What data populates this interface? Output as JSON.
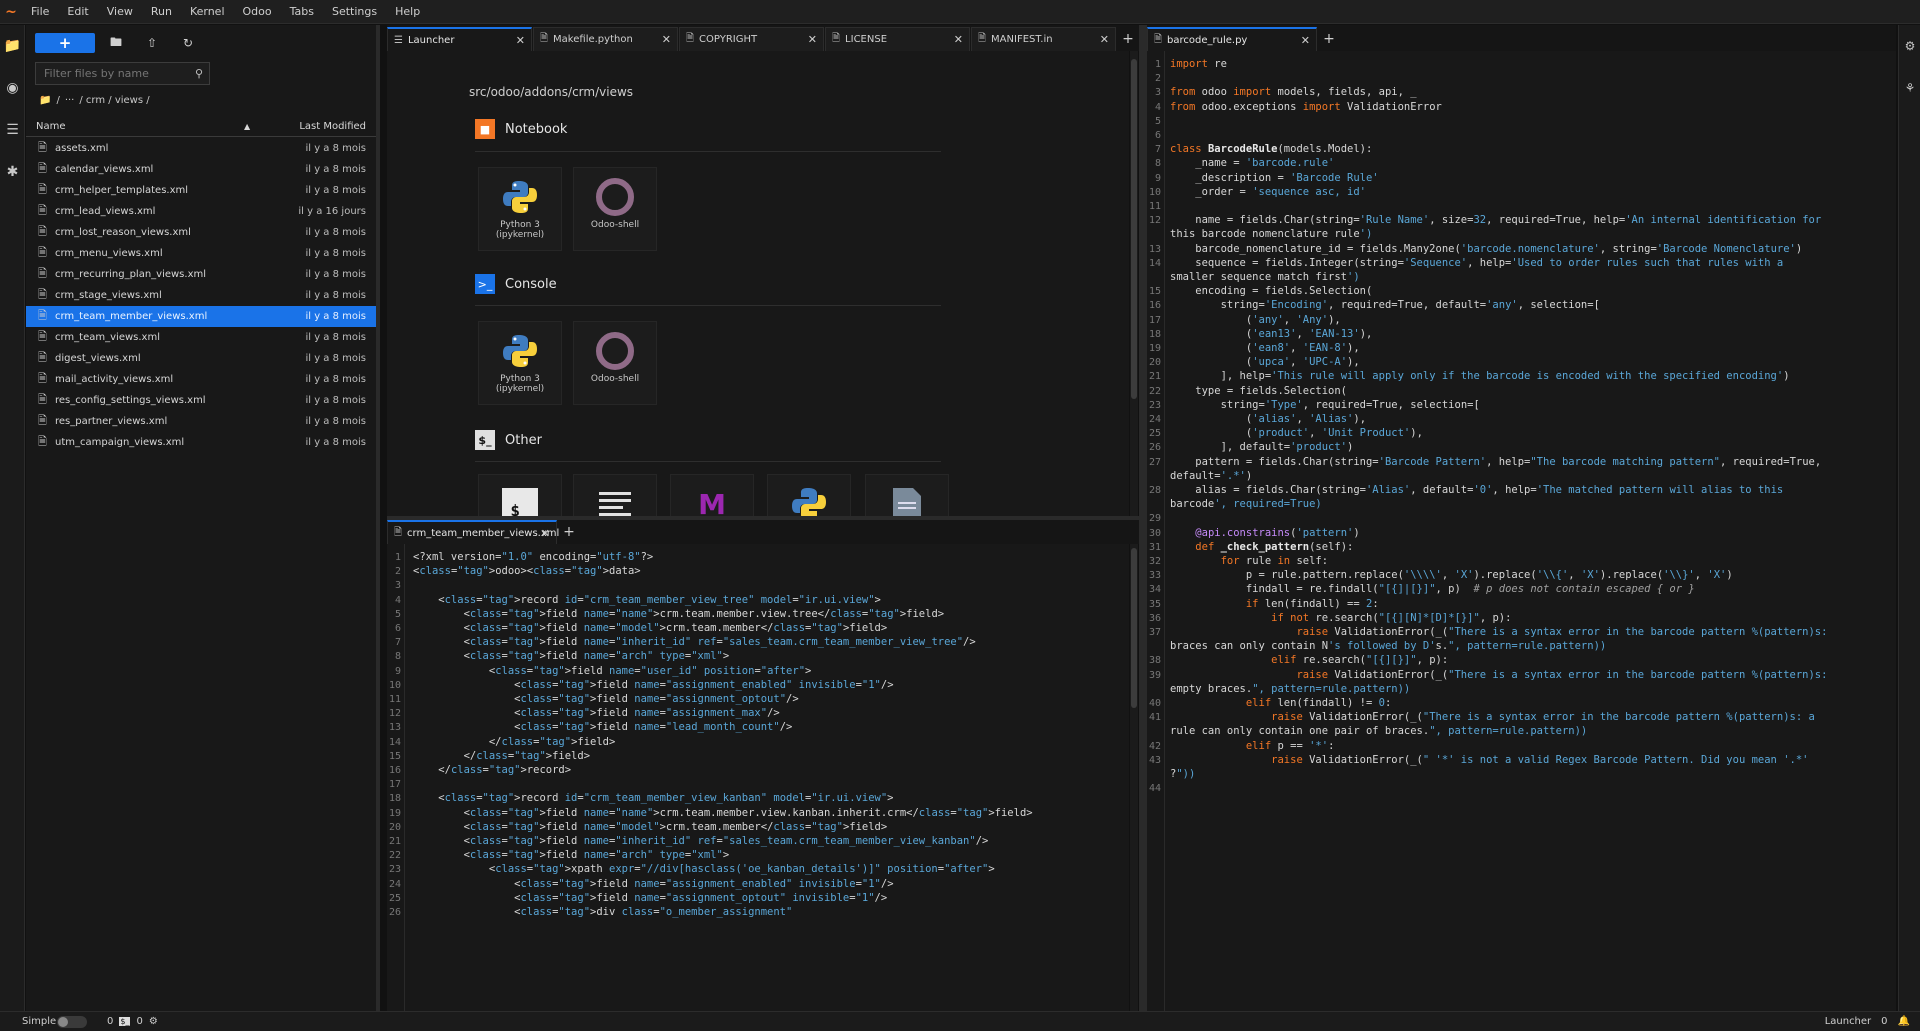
{
  "menubar": {
    "logo": "~",
    "items": [
      "File",
      "Edit",
      "View",
      "Run",
      "Kernel",
      "Odoo",
      "Tabs",
      "Settings",
      "Help"
    ]
  },
  "filebrowser": {
    "new_label": "+",
    "filter_placeholder": "Filter files by name",
    "breadcrumb": [
      "/",
      "···",
      "/ crm / views /"
    ],
    "col_name": "Name",
    "col_modified": "Last Modified",
    "files": [
      {
        "name": "assets.xml",
        "modified": "il y a 8 mois"
      },
      {
        "name": "calendar_views.xml",
        "modified": "il y a 8 mois"
      },
      {
        "name": "crm_helper_templates.xml",
        "modified": "il y a 8 mois"
      },
      {
        "name": "crm_lead_views.xml",
        "modified": "il y a 16 jours"
      },
      {
        "name": "crm_lost_reason_views.xml",
        "modified": "il y a 8 mois"
      },
      {
        "name": "crm_menu_views.xml",
        "modified": "il y a 8 mois"
      },
      {
        "name": "crm_recurring_plan_views.xml",
        "modified": "il y a 8 mois"
      },
      {
        "name": "crm_stage_views.xml",
        "modified": "il y a 8 mois"
      },
      {
        "name": "crm_team_member_views.xml",
        "modified": "il y a 8 mois",
        "selected": true
      },
      {
        "name": "crm_team_views.xml",
        "modified": "il y a 8 mois"
      },
      {
        "name": "digest_views.xml",
        "modified": "il y a 8 mois"
      },
      {
        "name": "mail_activity_views.xml",
        "modified": "il y a 8 mois"
      },
      {
        "name": "res_config_settings_views.xml",
        "modified": "il y a 8 mois"
      },
      {
        "name": "res_partner_views.xml",
        "modified": "il y a 8 mois"
      },
      {
        "name": "utm_campaign_views.xml",
        "modified": "il y a 8 mois"
      }
    ]
  },
  "top_tabs": [
    {
      "label": "Launcher",
      "active": true
    },
    {
      "label": "Makefile.python",
      "active": false
    },
    {
      "label": "COPYRIGHT",
      "active": false
    },
    {
      "label": "LICENSE",
      "active": false
    },
    {
      "label": "MANIFEST.in",
      "active": false
    }
  ],
  "right_tabs": [
    {
      "label": "barcode_rule.py",
      "active": true
    }
  ],
  "bottom_tabs": [
    {
      "label": "crm_team_member_views.xml",
      "active": true
    }
  ],
  "launcher": {
    "path": "src/odoo/addons/crm/views",
    "notebook_title": "Notebook",
    "console_title": "Console",
    "other_title": "Other",
    "kernels": [
      {
        "label_line1": "Python 3",
        "label_line2": "(ipykernel)"
      },
      {
        "label_line1": "Odoo-shell",
        "label_line2": ""
      }
    ]
  },
  "xml_code": [
    "<?xml version=\"1.0\" encoding=\"utf-8\"?>",
    "<odoo><data>",
    "",
    "    <record id=\"crm_team_member_view_tree\" model=\"ir.ui.view\">",
    "        <field name=\"name\">crm.team.member.view.tree</field>",
    "        <field name=\"model\">crm.team.member</field>",
    "        <field name=\"inherit_id\" ref=\"sales_team.crm_team_member_view_tree\"/>",
    "        <field name=\"arch\" type=\"xml\">",
    "            <field name=\"user_id\" position=\"after\">",
    "                <field name=\"assignment_enabled\" invisible=\"1\"/>",
    "                <field name=\"assignment_optout\"/>",
    "                <field name=\"assignment_max\"/>",
    "                <field name=\"lead_month_count\"/>",
    "            </field>",
    "        </field>",
    "    </record>",
    "",
    "    <record id=\"crm_team_member_view_kanban\" model=\"ir.ui.view\">",
    "        <field name=\"name\">crm.team.member.view.kanban.inherit.crm</field>",
    "        <field name=\"model\">crm.team.member</field>",
    "        <field name=\"inherit_id\" ref=\"sales_team.crm_team_member_view_kanban\"/>",
    "        <field name=\"arch\" type=\"xml\">",
    "            <xpath expr=\"//div[hasclass('oe_kanban_details')]\" position=\"after\">",
    "                <field name=\"assignment_enabled\" invisible=\"1\"/>",
    "                <field name=\"assignment_optout\" invisible=\"1\"/>",
    "                <div class=\"o_member_assignment\""
  ],
  "py_code": [
    {
      "n": "1",
      "t": "import re"
    },
    {
      "n": "2",
      "t": ""
    },
    {
      "n": "3",
      "t": "from odoo import models, fields, api, _"
    },
    {
      "n": "4",
      "t": "from odoo.exceptions import ValidationError"
    },
    {
      "n": "5",
      "t": ""
    },
    {
      "n": "6",
      "t": ""
    },
    {
      "n": "7",
      "t": "class BarcodeRule(models.Model):"
    },
    {
      "n": "8",
      "t": "    _name = 'barcode.rule'"
    },
    {
      "n": "9",
      "t": "    _description = 'Barcode Rule'"
    },
    {
      "n": "10",
      "t": "    _order = 'sequence asc, id'"
    },
    {
      "n": "11",
      "t": ""
    },
    {
      "n": "12",
      "t": "    name = fields.Char(string='Rule Name', size=32, required=True, help='An internal identification for"
    },
    {
      "n": "",
      "t": "this barcode nomenclature rule')"
    },
    {
      "n": "13",
      "t": "    barcode_nomenclature_id = fields.Many2one('barcode.nomenclature', string='Barcode Nomenclature')"
    },
    {
      "n": "14",
      "t": "    sequence = fields.Integer(string='Sequence', help='Used to order rules such that rules with a"
    },
    {
      "n": "",
      "t": "smaller sequence match first')"
    },
    {
      "n": "15",
      "t": "    encoding = fields.Selection("
    },
    {
      "n": "16",
      "t": "        string='Encoding', required=True, default='any', selection=["
    },
    {
      "n": "17",
      "t": "            ('any', 'Any'),"
    },
    {
      "n": "18",
      "t": "            ('ean13', 'EAN-13'),"
    },
    {
      "n": "19",
      "t": "            ('ean8', 'EAN-8'),"
    },
    {
      "n": "20",
      "t": "            ('upca', 'UPC-A'),"
    },
    {
      "n": "21",
      "t": "        ], help='This rule will apply only if the barcode is encoded with the specified encoding')"
    },
    {
      "n": "22",
      "t": "    type = fields.Selection("
    },
    {
      "n": "23",
      "t": "        string='Type', required=True, selection=["
    },
    {
      "n": "24",
      "t": "            ('alias', 'Alias'),"
    },
    {
      "n": "25",
      "t": "            ('product', 'Unit Product'),"
    },
    {
      "n": "26",
      "t": "        ], default='product')"
    },
    {
      "n": "27",
      "t": "    pattern = fields.Char(string='Barcode Pattern', help=\"The barcode matching pattern\", required=True,"
    },
    {
      "n": "",
      "t": "default='.*')"
    },
    {
      "n": "28",
      "t": "    alias = fields.Char(string='Alias', default='0', help='The matched pattern will alias to this"
    },
    {
      "n": "",
      "t": "barcode', required=True)"
    },
    {
      "n": "29",
      "t": ""
    },
    {
      "n": "30",
      "t": "    @api.constrains('pattern')"
    },
    {
      "n": "31",
      "t": "    def _check_pattern(self):"
    },
    {
      "n": "32",
      "t": "        for rule in self:"
    },
    {
      "n": "33",
      "t": "            p = rule.pattern.replace('\\\\\\\\', 'X').replace('\\\\{', 'X').replace('\\\\}', 'X')"
    },
    {
      "n": "34",
      "t": "            findall = re.findall(\"[{]|[}]\", p)  # p does not contain escaped { or }"
    },
    {
      "n": "35",
      "t": "            if len(findall) == 2:"
    },
    {
      "n": "36",
      "t": "                if not re.search(\"[{][N]*[D]*[}]\", p):"
    },
    {
      "n": "37",
      "t": "                    raise ValidationError(_(\"There is a syntax error in the barcode pattern %(pattern)s:"
    },
    {
      "n": "",
      "t": "braces can only contain N's followed by D's.\", pattern=rule.pattern))"
    },
    {
      "n": "38",
      "t": "                elif re.search(\"[{][}]\", p):"
    },
    {
      "n": "39",
      "t": "                    raise ValidationError(_(\"There is a syntax error in the barcode pattern %(pattern)s:"
    },
    {
      "n": "",
      "t": "empty braces.\", pattern=rule.pattern))"
    },
    {
      "n": "40",
      "t": "            elif len(findall) != 0:"
    },
    {
      "n": "41",
      "t": "                raise ValidationError(_(\"There is a syntax error in the barcode pattern %(pattern)s: a"
    },
    {
      "n": "",
      "t": "rule can only contain one pair of braces.\", pattern=rule.pattern))"
    },
    {
      "n": "42",
      "t": "            elif p == '*':"
    },
    {
      "n": "43",
      "t": "                raise ValidationError(_(\" '*' is not a valid Regex Barcode Pattern. Did you mean '.*'"
    },
    {
      "n": "",
      "t": "?\"))"
    },
    {
      "n": "44",
      "t": ""
    }
  ],
  "statusbar": {
    "mode_label": "Simple",
    "terminals_count": "0",
    "kernels_count": "0",
    "right_label": "Launcher",
    "notifications": "0"
  },
  "colors": {
    "accent": "#1a73e8",
    "keyword": "#f37726"
  }
}
